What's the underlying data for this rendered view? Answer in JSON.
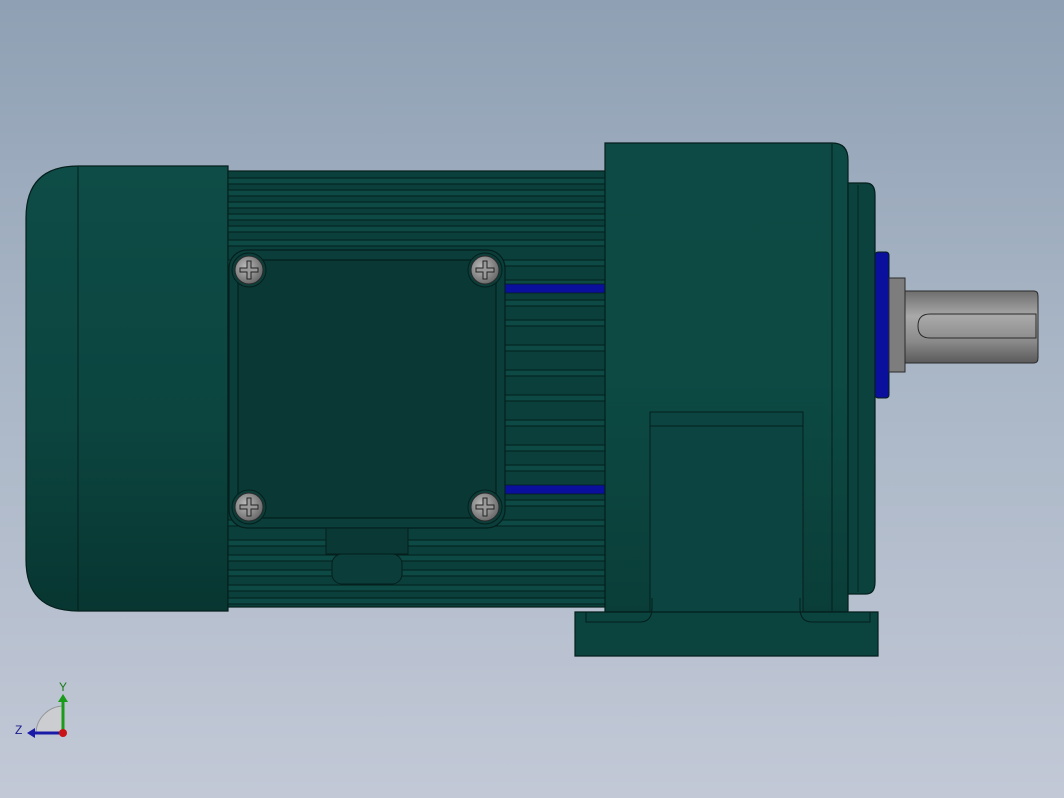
{
  "viewport": {
    "background_top": "#8fa0b4",
    "background_bottom": "#c2c8d6",
    "model_color": "#0d4a45",
    "accent_blue": "#0a0f9c",
    "shaft_color": "#9a9a9a"
  },
  "triad": {
    "y_label": "Y",
    "z_label": "Z",
    "y_color": "#1a9c1a",
    "z_color": "#1a1aa8",
    "x_color": "#c81414"
  }
}
